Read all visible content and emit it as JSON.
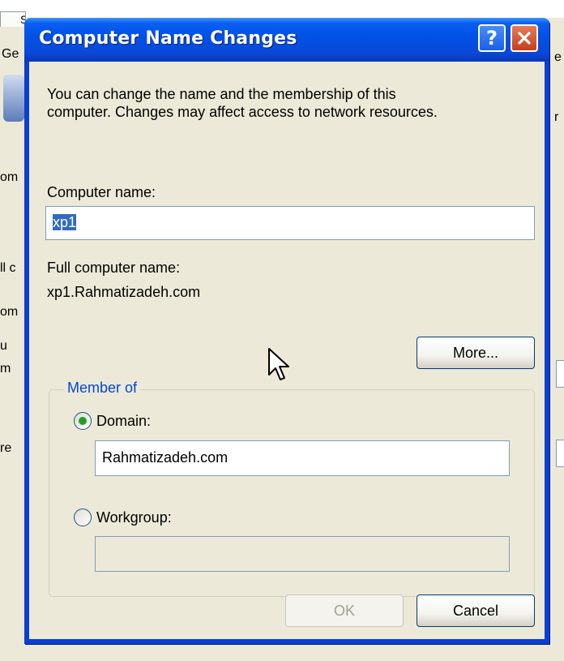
{
  "dialog": {
    "title": "Computer Name Changes",
    "description_line1": "You can change the name and the membership of this",
    "description_line2": "computer. Changes may affect access to network resources.",
    "computer_name_label": "Computer name:",
    "computer_name_value": "xp1",
    "full_name_label": "Full computer name:",
    "full_name_value": "xp1.Rahmatizadeh.com",
    "more_button": "More...",
    "member_of_label": "Member of",
    "domain_label": "Domain:",
    "domain_value": "Rahmatizadeh.com",
    "domain_selected": true,
    "workgroup_label": "Workgroup:",
    "workgroup_value": "",
    "ok_button": "OK",
    "cancel_button": "Cancel",
    "help_icon": "help-question-icon",
    "close_icon": "close-x-icon"
  },
  "background_window": {
    "tab_fragments": [
      "S",
      "Ge"
    ],
    "fragments": [
      "om",
      "ll c",
      "om",
      "u",
      "m",
      "re",
      "r",
      "e"
    ]
  },
  "colors": {
    "titlebar": "#0a5ff0",
    "close_button": "#c4401c",
    "selection": "#316ac5",
    "group_label": "#0046d5",
    "radio_dot": "#21a121"
  }
}
